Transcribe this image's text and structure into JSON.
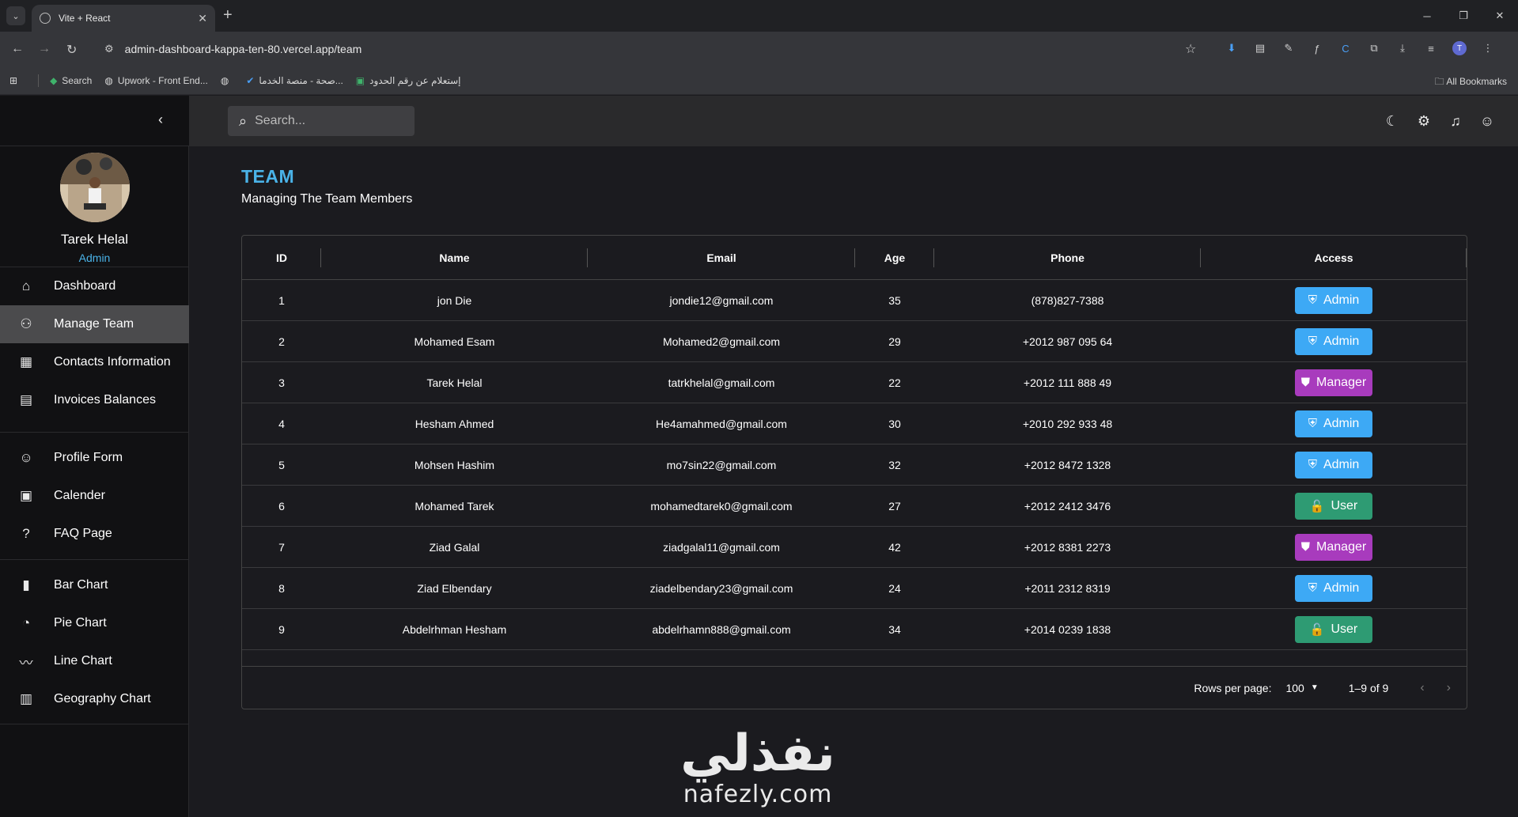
{
  "browser": {
    "tab_title": "Vite + React",
    "url": "admin-dashboard-kappa-ten-80.vercel.app/team",
    "bookmarks": [
      {
        "label": "Search"
      },
      {
        "label": "Upwork - Front End..."
      },
      {
        "label": ""
      },
      {
        "label": "صحة - منصة الخدما..."
      },
      {
        "label": "إستعلام عن رقم الحدود"
      }
    ],
    "all_bookmarks": "All Bookmarks",
    "profile_initial": "T"
  },
  "topbar": {
    "search_placeholder": "Search..."
  },
  "sidebar": {
    "user_name": "Tarek Helal",
    "user_role": "Admin",
    "groups": [
      [
        {
          "label": "Dashboard",
          "icon": "home-icon"
        },
        {
          "label": "Manage Team",
          "icon": "people-icon",
          "active": true
        },
        {
          "label": "Contacts Information",
          "icon": "contacts-icon"
        },
        {
          "label": "Invoices Balances",
          "icon": "receipt-icon"
        }
      ],
      [
        {
          "label": "Profile Form",
          "icon": "person-icon"
        },
        {
          "label": "Calender",
          "icon": "calendar-icon"
        },
        {
          "label": "FAQ Page",
          "icon": "help-icon"
        }
      ],
      [
        {
          "label": "Bar Chart",
          "icon": "bar-chart-icon"
        },
        {
          "label": "Pie Chart",
          "icon": "pie-chart-icon"
        },
        {
          "label": "Line Chart",
          "icon": "line-chart-icon"
        },
        {
          "label": "Geography Chart",
          "icon": "map-icon"
        }
      ]
    ]
  },
  "page": {
    "title": "TEAM",
    "subtitle": "Managing The Team Members"
  },
  "table": {
    "columns": [
      "ID",
      "Name",
      "Email",
      "Age",
      "Phone",
      "Access"
    ],
    "rows": [
      {
        "id": "1",
        "name": "jon Die",
        "email": "jondie12@gmail.com",
        "age": "35",
        "phone": "(878)827-7388",
        "access": "Admin"
      },
      {
        "id": "2",
        "name": "Mohamed Esam",
        "email": "Mohamed2@gmail.com",
        "age": "29",
        "phone": "+2012 987 095 64",
        "access": "Admin"
      },
      {
        "id": "3",
        "name": "Tarek Helal",
        "email": "tatrkhelal@gmail.com",
        "age": "22",
        "phone": "+2012 111 888 49",
        "access": "Manager"
      },
      {
        "id": "4",
        "name": "Hesham Ahmed",
        "email": "He4amahmed@gmail.com",
        "age": "30",
        "phone": "+2010 292 933 48",
        "access": "Admin"
      },
      {
        "id": "5",
        "name": "Mohsen Hashim",
        "email": "mo7sin22@gmail.com",
        "age": "32",
        "phone": "+2012 8472 1328",
        "access": "Admin"
      },
      {
        "id": "6",
        "name": "Mohamed Tarek",
        "email": "mohamedtarek0@gmail.com",
        "age": "27",
        "phone": "+2012 2412 3476",
        "access": "User"
      },
      {
        "id": "7",
        "name": "Ziad Galal",
        "email": "ziadgalal11@gmail.com",
        "age": "42",
        "phone": "+2012 8381 2273",
        "access": "Manager"
      },
      {
        "id": "8",
        "name": "Ziad Elbendary",
        "email": "ziadelbendary23@gmail.com",
        "age": "24",
        "phone": "+2011 2312 8319",
        "access": "Admin"
      },
      {
        "id": "9",
        "name": "Abdelrhman Hesham",
        "email": "abdelrhamn888@gmail.com",
        "age": "34",
        "phone": "+2014 0239 1838",
        "access": "User"
      }
    ],
    "footer": {
      "rows_per_page_label": "Rows per page:",
      "rows_per_page_value": "100",
      "range": "1–9 of 9"
    }
  },
  "watermark": {
    "arabic": "نفذلي",
    "latin": "nafezly.com"
  },
  "colors": {
    "accent": "#4ab3e8",
    "admin": "#3da9f5",
    "manager": "#a83bbd",
    "user": "#2e9b73"
  }
}
